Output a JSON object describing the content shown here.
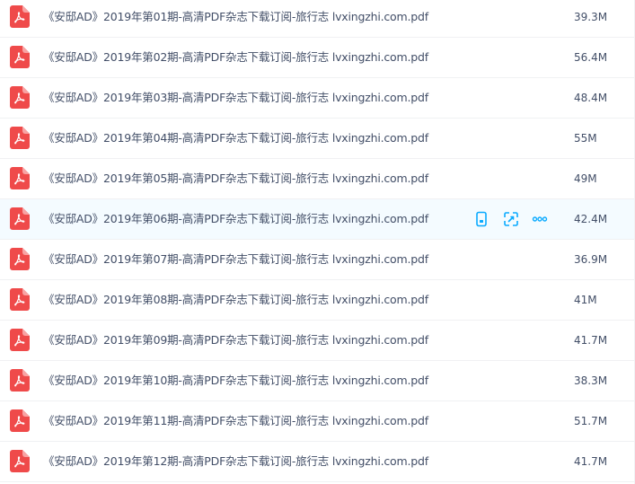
{
  "accent_color": "#09aaff",
  "pdf_icon_color": "#ef4a4a",
  "icons": {
    "file_type": "pdf-file-icon",
    "action_1": "phone-icon",
    "action_2": "link-share-icon",
    "action_3": "more-icon"
  },
  "files": [
    {
      "name": "《安邸AD》2019年第01期-高清PDF杂志下载订阅-旅行志 lvxingzhi.com.pdf",
      "size": "39.3M"
    },
    {
      "name": "《安邸AD》2019年第02期-高清PDF杂志下载订阅-旅行志 lvxingzhi.com.pdf",
      "size": "56.4M"
    },
    {
      "name": "《安邸AD》2019年第03期-高清PDF杂志下载订阅-旅行志 lvxingzhi.com.pdf",
      "size": "48.4M"
    },
    {
      "name": "《安邸AD》2019年第04期-高清PDF杂志下载订阅-旅行志 lvxingzhi.com.pdf",
      "size": "55M"
    },
    {
      "name": "《安邸AD》2019年第05期-高清PDF杂志下载订阅-旅行志 lvxingzhi.com.pdf",
      "size": "49M"
    },
    {
      "name": "《安邸AD》2019年第06期-高清PDF杂志下载订阅-旅行志 lvxingzhi.com.pdf",
      "size": "42.4M"
    },
    {
      "name": "《安邸AD》2019年第07期-高清PDF杂志下载订阅-旅行志 lvxingzhi.com.pdf",
      "size": "36.9M"
    },
    {
      "name": "《安邸AD》2019年第08期-高清PDF杂志下载订阅-旅行志 lvxingzhi.com.pdf",
      "size": "41M"
    },
    {
      "name": "《安邸AD》2019年第09期-高清PDF杂志下载订阅-旅行志 lvxingzhi.com.pdf",
      "size": "41.7M"
    },
    {
      "name": "《安邸AD》2019年第10期-高清PDF杂志下载订阅-旅行志 lvxingzhi.com.pdf",
      "size": "38.3M"
    },
    {
      "name": "《安邸AD》2019年第11期-高清PDF杂志下载订阅-旅行志 lvxingzhi.com.pdf",
      "size": "51.7M"
    },
    {
      "name": "《安邸AD》2019年第12期-高清PDF杂志下载订阅-旅行志 lvxingzhi.com.pdf",
      "size": "41.7M"
    }
  ]
}
